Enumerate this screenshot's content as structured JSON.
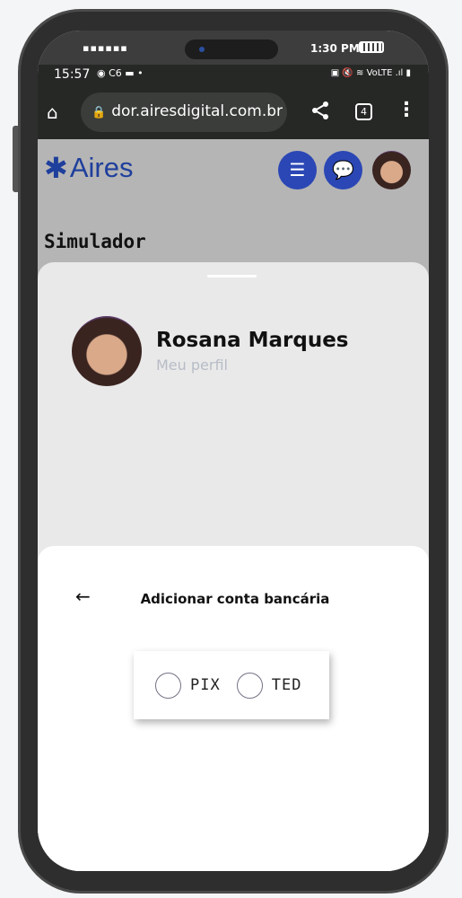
{
  "mockup_status": {
    "signal": "▪▪▪▪▪▪",
    "time": "1:30 PM"
  },
  "android_status": {
    "time": "15:57",
    "left_icons": "◉ C6 ▬ •",
    "right_icons": "▣ 🔇 ≋ VoLTE .ıl ▮"
  },
  "browser": {
    "url": "dor.airesdigital.com.br",
    "tab_count": "4",
    "home_icon": "⌂",
    "share_icon": "share",
    "more_icon": "⋮"
  },
  "header": {
    "logo_text": "Aires",
    "brand_color": "#1f3f9c",
    "button_color": "#2b47b5"
  },
  "page_title": "Simulador",
  "profile": {
    "name": "Rosana Marques",
    "subtitle": "Meu perfil"
  },
  "dialog": {
    "back_icon": "←",
    "title": "Adicionar conta bancária",
    "options": [
      {
        "label": "PIX",
        "selected": false
      },
      {
        "label": "TED",
        "selected": false
      }
    ]
  }
}
